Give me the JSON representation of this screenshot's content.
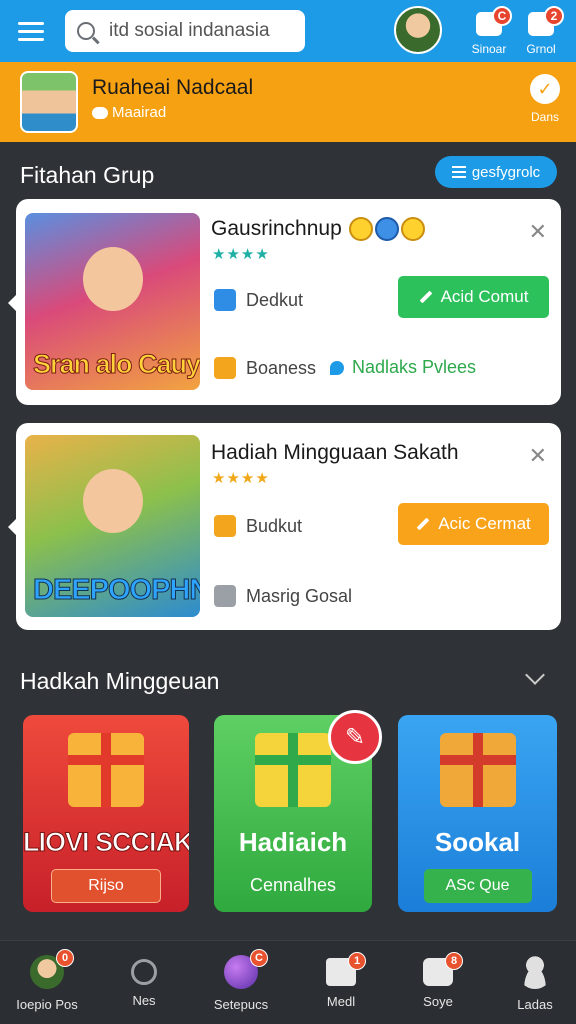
{
  "topbar": {
    "search_value": "itd sosial indanasia",
    "icons": [
      {
        "name": "notifications",
        "label": "Sinoar",
        "badge": "C"
      },
      {
        "name": "messages",
        "label": "Grnol",
        "badge": "2"
      }
    ]
  },
  "profile": {
    "name": "Ruaheai Nadcaal",
    "subtitle": "Maairad",
    "action_label": "Dans"
  },
  "section1": {
    "title": "Fitahan Grup",
    "filter_label": "gesfygrolc"
  },
  "cards": [
    {
      "thumb_text": "Sran alo Cauy",
      "title": "Gausrinchnup",
      "stars": "★★★★",
      "star_color": "#1fb0a5",
      "item1": "Dedkut",
      "button": "Acid Comut",
      "item2": "Boaness",
      "link": "Nadlaks Pvlees"
    },
    {
      "thumb_text": "DEEPOOPHN",
      "title": "Hadiah Mingguaan Sakath",
      "stars": "★★★★",
      "star_color": "#f0a818",
      "item1": "Budkut",
      "button": "Acic Cermat",
      "item2": "Masrig Gosal"
    }
  ],
  "section2": {
    "title": "Hadkah Minggeuan"
  },
  "tiles": [
    {
      "title": "LIOVI SCCIAK",
      "button": "Rijso"
    },
    {
      "title": "Hadiaich",
      "sub": "Cennalhes"
    },
    {
      "title": "Sookal",
      "button": "ASc Que"
    }
  ],
  "bottom_nav": [
    {
      "label": "Ioepio Pos",
      "badge": "0"
    },
    {
      "label": "Nes"
    },
    {
      "label": "Setepucs",
      "badge": "C"
    },
    {
      "label": "Medl",
      "badge": "1"
    },
    {
      "label": "Soye",
      "badge": "8"
    },
    {
      "label": "Ladas"
    }
  ]
}
